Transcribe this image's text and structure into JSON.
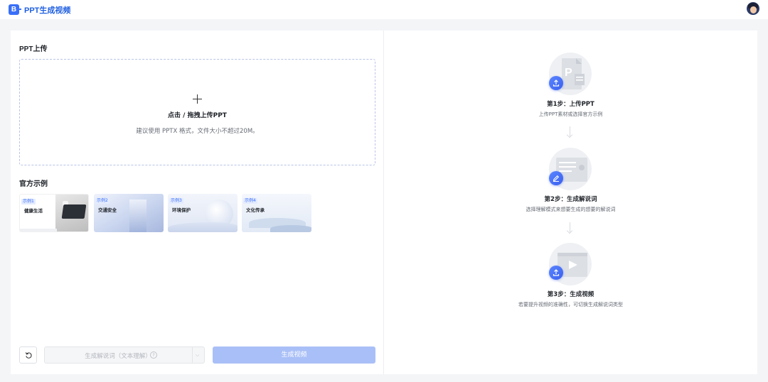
{
  "app": {
    "title": "PPT生成视频",
    "logo_letter": "B"
  },
  "colors": {
    "accent": "#3a6ff7",
    "brand_title": "#1f5fe0",
    "primary_button_disabled": "#a9bff7"
  },
  "upload": {
    "section_title": "PPT上传",
    "action_text": "点击 / 拖拽上传PPT",
    "hint": "建议使用 PPTX 格式，文件大小不超过20M。",
    "icon": "plus-icon"
  },
  "examples": {
    "section_title": "官方示例",
    "items": [
      {
        "tag": "示例1",
        "name": "健康生活"
      },
      {
        "tag": "示例2",
        "name": "交通安全"
      },
      {
        "tag": "示例3",
        "name": "环境保护"
      },
      {
        "tag": "示例4",
        "name": "文化传承"
      }
    ]
  },
  "controls": {
    "reset_icon": "reset-icon",
    "generate_select_label": "生成解说词（文本理解）",
    "help_icon_glyph": "?",
    "chevron_glyph": "⌵",
    "generate_video_label": "生成视频"
  },
  "steps": [
    {
      "title": "第1步：上传PPT",
      "desc": "上传PPT素材或选择官方示例",
      "icon": "upload-icon"
    },
    {
      "title": "第2步：生成解说词",
      "desc": "选择理解模式来想要生成的想要的解说词",
      "icon": "edit-icon"
    },
    {
      "title": "第3步：生成视频",
      "desc": "若要提升视频的准确性，可切换生成解说词类型",
      "icon": "upload-icon"
    }
  ]
}
